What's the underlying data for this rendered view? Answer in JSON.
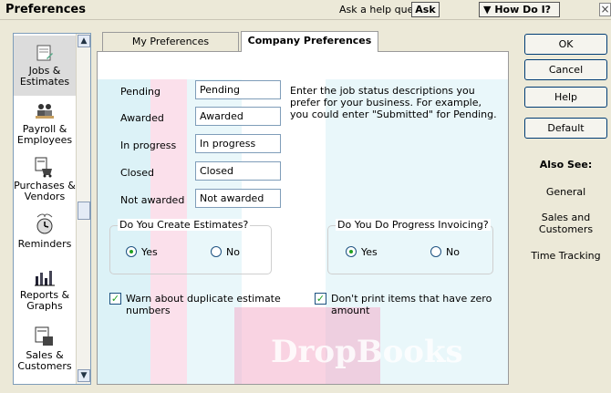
{
  "window": {
    "title": "Preferences"
  },
  "help": {
    "question_label": "Ask a help question",
    "ask_button": "Ask",
    "how_do_i": "How Do I?",
    "close": "×"
  },
  "sidebar": {
    "items": [
      {
        "label": "Jobs & Estimates",
        "icon": "jobs-estimates-icon",
        "selected": true
      },
      {
        "label": "Payroll & Employees",
        "icon": "payroll-employees-icon"
      },
      {
        "label": "Purchases & Vendors",
        "icon": "purchases-vendors-icon"
      },
      {
        "label": "Reminders",
        "icon": "reminders-icon"
      },
      {
        "label": "Reports & Graphs",
        "icon": "reports-graphs-icon"
      },
      {
        "label": "Sales & Customers",
        "icon": "sales-customers-icon"
      }
    ]
  },
  "tabs": [
    {
      "label": "My Preferences",
      "active": false
    },
    {
      "label": "Company Preferences",
      "active": true
    }
  ],
  "job_status": {
    "rows": [
      {
        "label": "Pending",
        "value": "Pending"
      },
      {
        "label": "Awarded",
        "value": "Awarded"
      },
      {
        "label": "In progress",
        "value": "In progress"
      },
      {
        "label": "Closed",
        "value": "Closed"
      },
      {
        "label": "Not awarded",
        "value": "Not awarded"
      }
    ],
    "description": "Enter the job status descriptions you prefer for your business.  For example, you could enter \"Submitted\" for Pending."
  },
  "estimates_group": {
    "title": "Do You Create Estimates?",
    "yes": "Yes",
    "no": "No",
    "selected": "yes"
  },
  "progress_group": {
    "title": "Do You Do Progress Invoicing?",
    "yes": "Yes",
    "no": "No",
    "selected": "yes"
  },
  "checkboxes": {
    "warn_duplicate": {
      "label": "Warn about duplicate estimate numbers",
      "checked": true
    },
    "dont_print_zero": {
      "label": "Don't print items that have zero amount",
      "checked": true
    }
  },
  "buttons": {
    "ok": "OK",
    "cancel": "Cancel",
    "help": "Help",
    "default": "Default"
  },
  "also_see": {
    "title": "Also See:",
    "links": [
      "General",
      "Sales and Customers",
      "Time Tracking"
    ]
  },
  "watermark": "DropBooks",
  "colors": {
    "watermark_pink": "#f3a7c6",
    "watermark_cyan": "#bfe8f0",
    "radio_green": "#21a121"
  }
}
